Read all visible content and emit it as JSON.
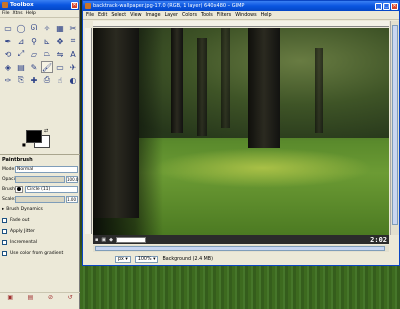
{
  "toolbox": {
    "title": "Toolbox",
    "menu": [
      "File",
      "Xtns",
      "Help"
    ],
    "tools": [
      {
        "icon": "rect-select-icon",
        "glyph": "▭"
      },
      {
        "icon": "ellipse-select-icon",
        "glyph": "◯"
      },
      {
        "icon": "free-select-icon",
        "glyph": "ᘏ"
      },
      {
        "icon": "fuzzy-select-icon",
        "glyph": "✧"
      },
      {
        "icon": "color-select-icon",
        "glyph": "▦"
      },
      {
        "icon": "scissors-icon",
        "glyph": "✂"
      },
      {
        "icon": "paths-icon",
        "glyph": "✒"
      },
      {
        "icon": "color-picker-icon",
        "glyph": "⊿"
      },
      {
        "icon": "zoom-icon",
        "glyph": "⚲"
      },
      {
        "icon": "measure-icon",
        "glyph": "⊾"
      },
      {
        "icon": "move-icon",
        "glyph": "✥"
      },
      {
        "icon": "crop-icon",
        "glyph": "⌗"
      },
      {
        "icon": "rotate-icon",
        "glyph": "⟲"
      },
      {
        "icon": "scale-icon",
        "glyph": "⤢"
      },
      {
        "icon": "shear-icon",
        "glyph": "▱"
      },
      {
        "icon": "perspective-icon",
        "glyph": "⏢"
      },
      {
        "icon": "flip-icon",
        "glyph": "⇋"
      },
      {
        "icon": "text-icon",
        "glyph": "A"
      },
      {
        "icon": "bucket-fill-icon",
        "glyph": "◈"
      },
      {
        "icon": "blend-icon",
        "glyph": "▤"
      },
      {
        "icon": "pencil-icon",
        "glyph": "✎"
      },
      {
        "icon": "paintbrush-icon",
        "glyph": "🖌"
      },
      {
        "icon": "eraser-icon",
        "glyph": "▭"
      },
      {
        "icon": "airbrush-icon",
        "glyph": "✈"
      },
      {
        "icon": "ink-icon",
        "glyph": "✑"
      },
      {
        "icon": "clone-icon",
        "glyph": "⎘"
      },
      {
        "icon": "heal-icon",
        "glyph": "✚"
      },
      {
        "icon": "perspective-clone-icon",
        "glyph": "⎙"
      },
      {
        "icon": "smudge-icon",
        "glyph": "☝"
      },
      {
        "icon": "dodge-burn-icon",
        "glyph": "◐"
      }
    ],
    "active_tool": 21,
    "fg_color": "#000000",
    "bg_color": "#ffffff",
    "options": {
      "title": "Paintbrush",
      "mode_label": "Mode:",
      "mode_value": "Normal",
      "opacity_label": "Opacity:",
      "opacity_value": "100.0",
      "brush_label": "Brush:",
      "brush_value": "Circle (11)",
      "scale_label": "Scale:",
      "scale_value": "1.00",
      "dynamics_label": "Brush Dynamics",
      "checks": [
        "Fade out",
        "Apply Jitter",
        "Incremental",
        "Use color from gradient"
      ]
    }
  },
  "image_window": {
    "title": "backtrack-wallpaper.jpg-17.0 (RGB, 1 layer) 640x480 – GIMP",
    "menu": [
      "File",
      "Edit",
      "Select",
      "View",
      "Image",
      "Layer",
      "Colors",
      "Tools",
      "Filters",
      "Windows",
      "Help"
    ],
    "status_clock": "2:02",
    "unit": "px",
    "zoom": "100%",
    "layer_info": "Background (2.4 MB)"
  }
}
